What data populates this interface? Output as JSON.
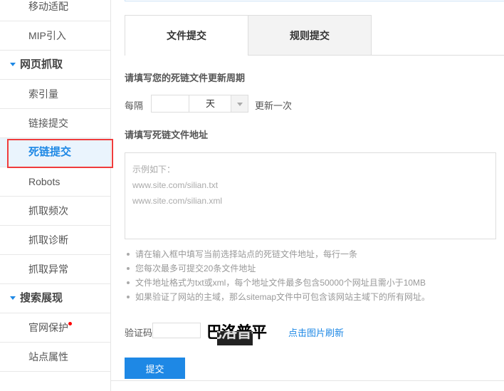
{
  "sidebar": {
    "items": [
      {
        "label": "移动适配"
      },
      {
        "label": "MIP引入"
      },
      {
        "label": "网页抓取"
      },
      {
        "label": "索引量"
      },
      {
        "label": "链接提交"
      },
      {
        "label": "死链提交"
      },
      {
        "label": "Robots"
      },
      {
        "label": "抓取频次"
      },
      {
        "label": "抓取诊断"
      },
      {
        "label": "抓取异常"
      },
      {
        "label": "搜索展现"
      },
      {
        "label": "官网保护"
      },
      {
        "label": "站点属性"
      }
    ]
  },
  "tabs": [
    {
      "label": "文件提交"
    },
    {
      "label": "规则提交"
    }
  ],
  "form": {
    "period_heading": "请填写您的死链文件更新周期",
    "every_label": "每隔",
    "interval_value": "",
    "unit_selected": "天",
    "once_label": "更新一次",
    "address_heading": "请填写死链文件地址",
    "textarea_placeholder": [
      "示例如下：",
      "www.site.com/silian.txt",
      "www.site.com/silian.xml"
    ],
    "tips": [
      "请在输入框中填写当前选择站点的死链文件地址，每行一条",
      "您每次最多可提交20条文件地址",
      "文件地址格式为txt或xml，每个地址文件最多包含50000个网址且需小于10MB",
      "如果验证了网站的主域，那么sitemap文件中可包含该网站主域下的所有网址。"
    ],
    "captcha_label": "验证码",
    "captcha_value": "",
    "captcha_image_text": "巴洛普平",
    "refresh_label": "点击图片刷新",
    "submit_label": "提交"
  },
  "colors": {
    "accent": "#1e88e5",
    "highlight_box": "#f03c3c"
  }
}
